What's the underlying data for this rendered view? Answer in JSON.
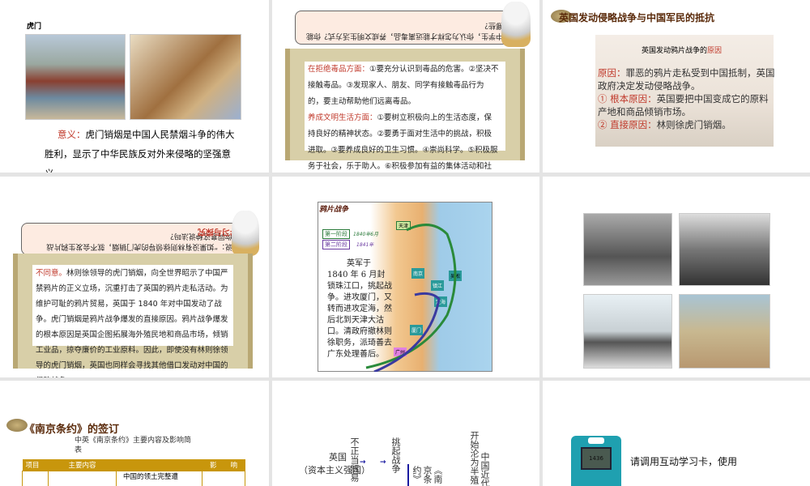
{
  "slides": [
    {
      "title": "虎门销烟",
      "meaning_label": "意义：",
      "meaning_text": "虎门销烟是中国人民禁烟斗争的伟大胜利，显示了中华民族反对外来侵略的坚强意义"
    },
    {
      "bubble": "作为中学生，你认为怎样才能远离毒品，养成文明生活方式？你能做到哪些？",
      "p1_label": "在拒绝毒品方面：",
      "p1_text": "①要充分认识到毒品的危害。②坚决不接触毒品。③发现家人、朋友、同学有接触毒品行为的，要主动帮助他们远离毒品。",
      "p2_label": "养成文明生活方面：",
      "p2_text": "①要树立积极向上的生活态度，保持良好的精神状态。②要勇于面对生活中的挑战，积极进取。③要养成良好的卫生习惯。④崇尚科学。⑤积极服务于社会，乐于助人。⑥积极参加有益的集体活动和社会实践活动。"
    },
    {
      "heading": "英国发动侵略战争与中国军民的抵抗",
      "subtitle": "英国发动鸦片战争的",
      "subtitle_red": "原因",
      "l1_label": "原因：",
      "l1_text": "罪恶的鸦片走私受到中国抵制，英国政府决定发动侵略战争。",
      "l2_label": "① 根本原因：",
      "l2_text": "英国要把中国变成它的原料产地和商品倾销市场。",
      "l3_label": "② 直接原因：",
      "l3_text": "林则徐虎门销烟。"
    },
    {
      "bubble": "有人说：“如果没有林则徐领导的虎门销烟，就不会发生鸦片战争。”你同意这种说法吗？",
      "badge": "学习与探究",
      "label": "不同意。",
      "text": "林则徐领导的虎门销烟，向全世界昭示了中国严禁鸦片的正义立场，沉重打击了英国的鸦片走私活动。为维护可耻的鸦片贸易，英国于 1840 年对中国发动了战争。虎门销烟是鸦片战争爆发的直接原因。鸦片战争爆发的根本原因是英国企图拓展海外殖民地和商品市场，倾销工业品，掠夺廉价的工业原料。因此，即使没有林则徐领导的虎门销烟，英国也同样会寻找其他借口发动对中国的侵略战争。"
    },
    {
      "map_title": "鸦片战争",
      "legend1": "第一阶段",
      "legend1_date": "1840年6月",
      "legend2": "第二阶段",
      "legend2_date": "1841年",
      "places": [
        "天津",
        "南京",
        "镇江",
        "吴淞",
        "定海",
        "厦门",
        "广州"
      ],
      "text": "英军于 1840 年 6 月封锁珠江口，挑起战争。进攻厦门，又转而进攻定海，然后北到天津大沽口。清政府撤林则徐职务，派琦善去广东处理善后。"
    },
    {
      "photos": 4
    },
    {
      "heading": "《南京条约》的签订",
      "caption": "中英《南京条约》主要内容及影响简表",
      "columns": [
        "项目",
        "主要内容",
        "",
        "影　　响"
      ],
      "cell": "中国的领土完整遭"
    },
    {
      "left_a": "英国",
      "left_b": "（资本主义强国）",
      "c1": "不正当贸易",
      "c2": "挑起战争",
      "c3": "《南京条约》",
      "c4": "开始沦为半殖",
      "c5": "中国近代"
    },
    {
      "device_screen": "1436",
      "text": "请调用互动学习卡，使用"
    }
  ],
  "colors": {
    "accent_red": "#c0392b",
    "gap": "#e4e4e4",
    "table_header": "#c8960c"
  }
}
